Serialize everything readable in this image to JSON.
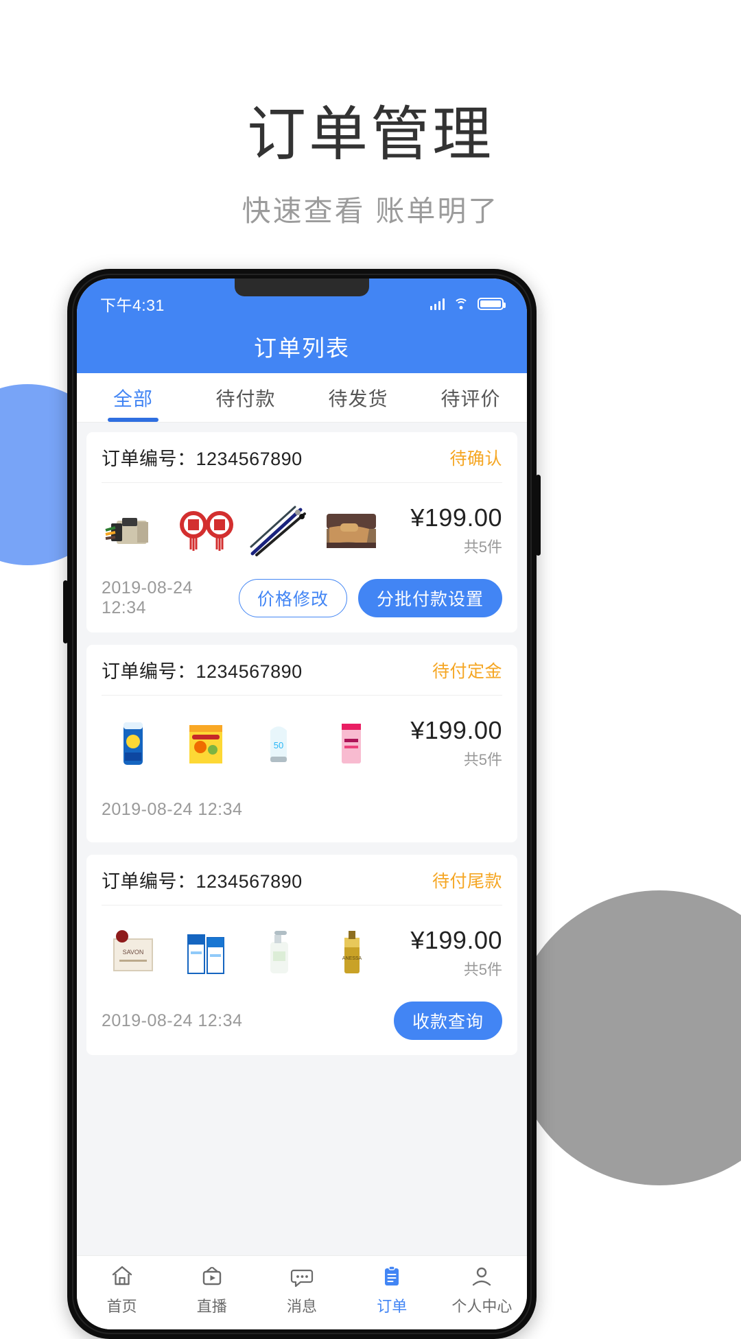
{
  "promo": {
    "title": "订单管理",
    "subtitle": "快速查看  账单明了"
  },
  "colors": {
    "brand_blue": "#4285f4",
    "status_orange": "#f5a623",
    "deco_blue": "#78a4f7",
    "deco_gray": "#9e9e9e"
  },
  "statusbar": {
    "time": "下午4:31",
    "icons": [
      "signal-icon",
      "wifi-icon",
      "battery-icon"
    ]
  },
  "appbar": {
    "title": "订单列表"
  },
  "tabs": [
    {
      "label": "全部",
      "active": true
    },
    {
      "label": "待付款",
      "active": false
    },
    {
      "label": "待发货",
      "active": false
    },
    {
      "label": "待评价",
      "active": false
    }
  ],
  "orders": [
    {
      "order_no_label": "订单编号：",
      "order_no": "1234567890",
      "status": "待确认",
      "price": "¥199.00",
      "currency": "¥",
      "amount": "199.00",
      "qty": "共5件",
      "date": "2019-08-24 12:34",
      "thumbs": [
        "connector-thumb",
        "chinese-knot-thumb",
        "fishing-rod-thumb",
        "sofa-bed-thumb"
      ],
      "buttons": [
        {
          "label": "价格修改",
          "style": "outline"
        },
        {
          "label": "分批付款设置",
          "style": "primary"
        }
      ]
    },
    {
      "order_no_label": "订单编号：",
      "order_no": "1234567890",
      "status": "待付定金",
      "price": "¥199.00",
      "currency": "¥",
      "amount": "199.00",
      "qty": "共5件",
      "date": "2019-08-24 12:34",
      "thumbs": [
        "chips-can-thumb",
        "snack-pouch-thumb",
        "sunscreen-thumb",
        "pink-pouch-thumb"
      ],
      "buttons": []
    },
    {
      "order_no_label": "订单编号：",
      "order_no": "1234567890",
      "status": "待付尾款",
      "price": "¥199.00",
      "currency": "¥",
      "amount": "199.00",
      "qty": "共5件",
      "date": "2019-08-24 12:34",
      "thumbs": [
        "soap-box-thumb",
        "blue-box-thumb",
        "lotion-pump-thumb",
        "gold-spray-thumb"
      ],
      "buttons": [
        {
          "label": "收款查询",
          "style": "primary"
        }
      ]
    }
  ],
  "bottom_nav": [
    {
      "label": "首页",
      "icon": "home-icon",
      "active": false
    },
    {
      "label": "直播",
      "icon": "live-icon",
      "active": false
    },
    {
      "label": "消息",
      "icon": "message-icon",
      "active": false
    },
    {
      "label": "订单",
      "icon": "order-icon",
      "active": true
    },
    {
      "label": "个人中心",
      "icon": "profile-icon",
      "active": false
    }
  ]
}
